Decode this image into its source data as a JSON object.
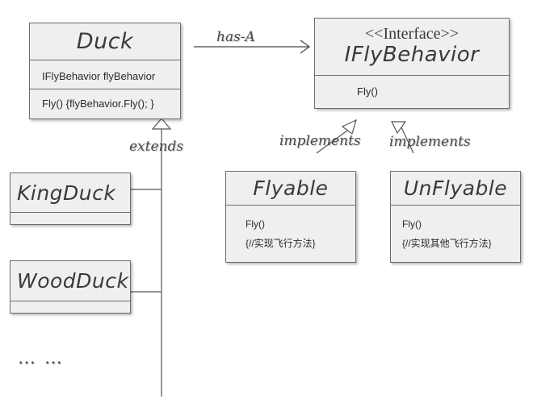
{
  "duck": {
    "name": "Duck",
    "attribute": "IFlyBehavior flyBehavior",
    "method": "Fly() {flyBehavior.Fly(); }"
  },
  "fly_interface": {
    "stereotype": "<<Interface>>",
    "name": "IFlyBehavior",
    "method": "Fly()"
  },
  "flyable": {
    "name": "Flyable",
    "method": "Fly()",
    "body": "{//实现飞行方法}"
  },
  "unflyable": {
    "name": "UnFlyable",
    "method": "Fly()",
    "body": "{//实现其他飞行方法}"
  },
  "king_duck": {
    "name": "KingDuck"
  },
  "wood_duck": {
    "name": "WoodDuck"
  },
  "labels": {
    "has_a": "has-A",
    "extends": "extends",
    "implements_left": "implements",
    "implements_right": "implements",
    "more": "… …"
  }
}
